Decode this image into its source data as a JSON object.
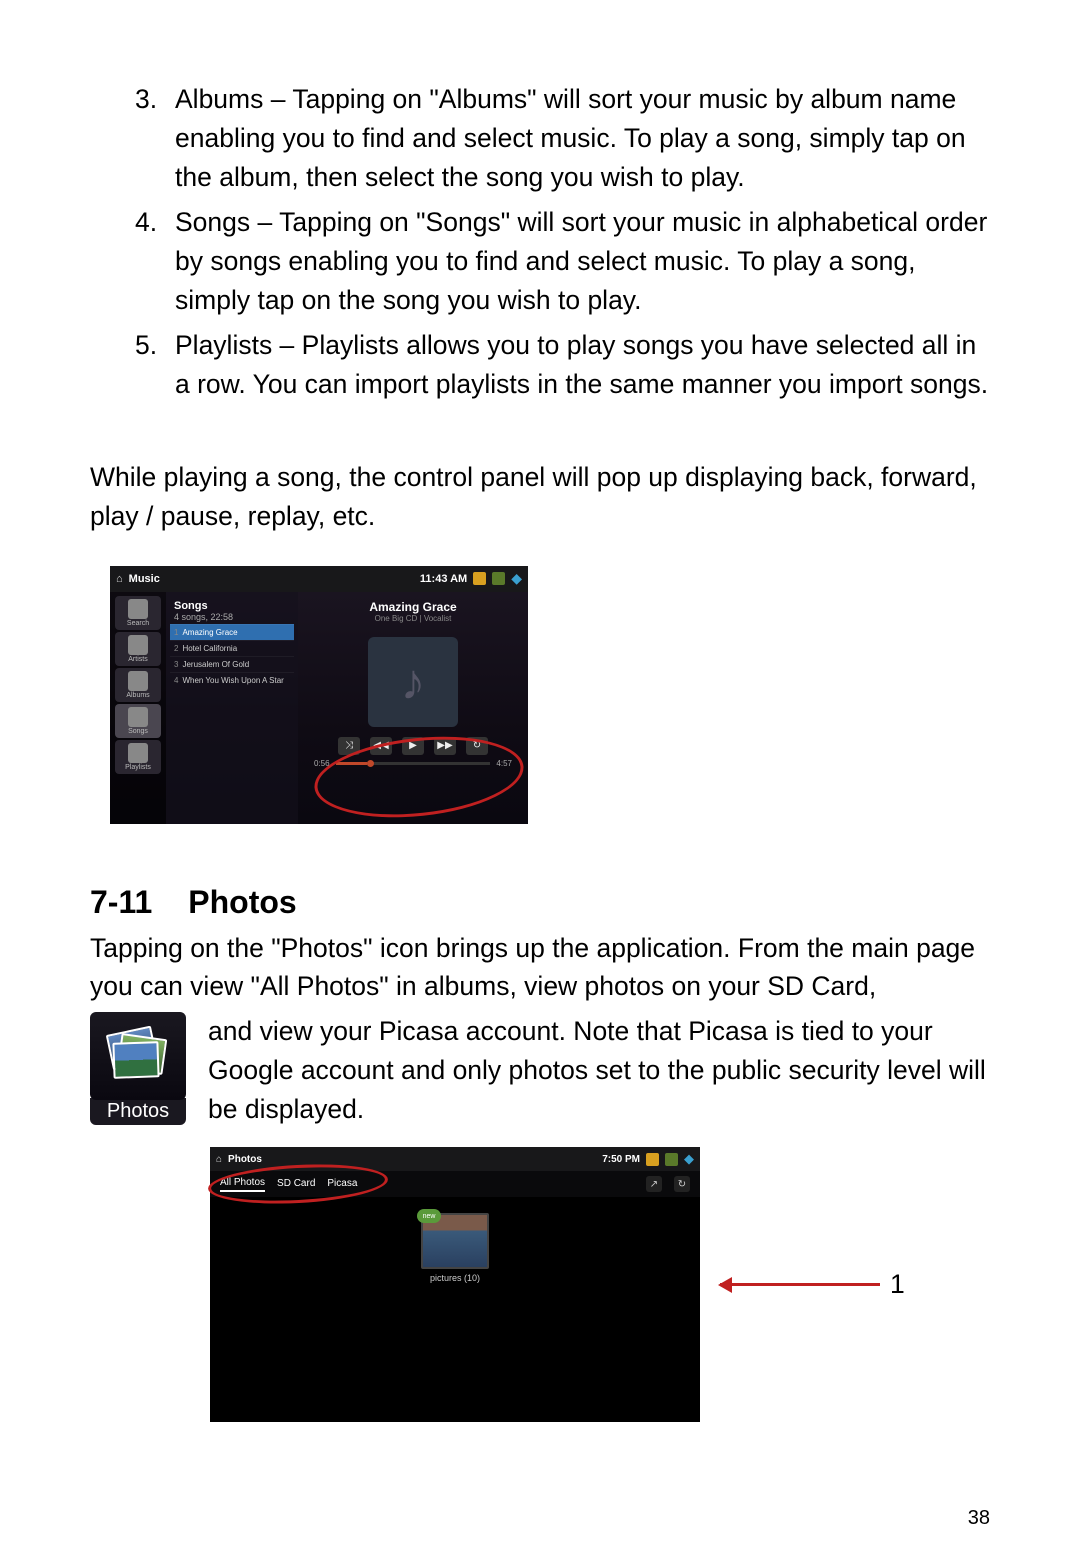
{
  "list": {
    "items": [
      {
        "num": "3.",
        "text": "Albums – Tapping on \"Albums\" will sort your music by album name enabling you to find and select music.    To play a song, simply tap on the album, then select the song you wish to play."
      },
      {
        "num": "4.",
        "text": "Songs – Tapping on \"Songs\" will sort your music in alphabetical order by songs enabling you to find and select music.    To play a song, simply tap on the song you wish to play."
      },
      {
        "num": "5.",
        "text": "Playlists – Playlists allows you to play songs you have selected all in a row.    You can import playlists in the same manner you import songs."
      }
    ]
  },
  "para1": "While playing a song, the control panel will pop up displaying back, forward, play / pause, replay, etc.",
  "music": {
    "app": "Music",
    "clock": "11:43 AM",
    "side": [
      {
        "label": "Search"
      },
      {
        "label": "Artists"
      },
      {
        "label": "Albums"
      },
      {
        "label": "Songs"
      },
      {
        "label": "Playlists"
      }
    ],
    "list_title": "Songs",
    "list_sub": "4 songs, 22:58",
    "rows": [
      {
        "n": "1",
        "t": "Amazing Grace"
      },
      {
        "n": "2",
        "t": "Hotel California"
      },
      {
        "n": "3",
        "t": "Jerusalem Of Gold"
      },
      {
        "n": "4",
        "t": "When You Wish Upon A Star"
      }
    ],
    "np_title": "Amazing Grace",
    "np_sub": "One Big CD | Vocalist",
    "pos": "0:56",
    "dur": "4:57"
  },
  "section": {
    "num": "7-11",
    "title": "Photos"
  },
  "photos_intro": "Tapping on the \"Photos\" icon brings up the application.    From the main page you can view \"All Photos\" in albums, view photos on your SD Card,",
  "photos_rest": "and view your Picasa account.    Note that Picasa is tied to your Google account and only photos set to the public security level will be displayed.",
  "photos_icon_label": "Photos",
  "gallery": {
    "app": "Photos",
    "clock": "7:50 PM",
    "tabs": [
      "All Photos",
      "SD Card",
      "Picasa"
    ],
    "album_label": "pictures (10)",
    "badge": "new"
  },
  "callout": "1",
  "page": "38"
}
